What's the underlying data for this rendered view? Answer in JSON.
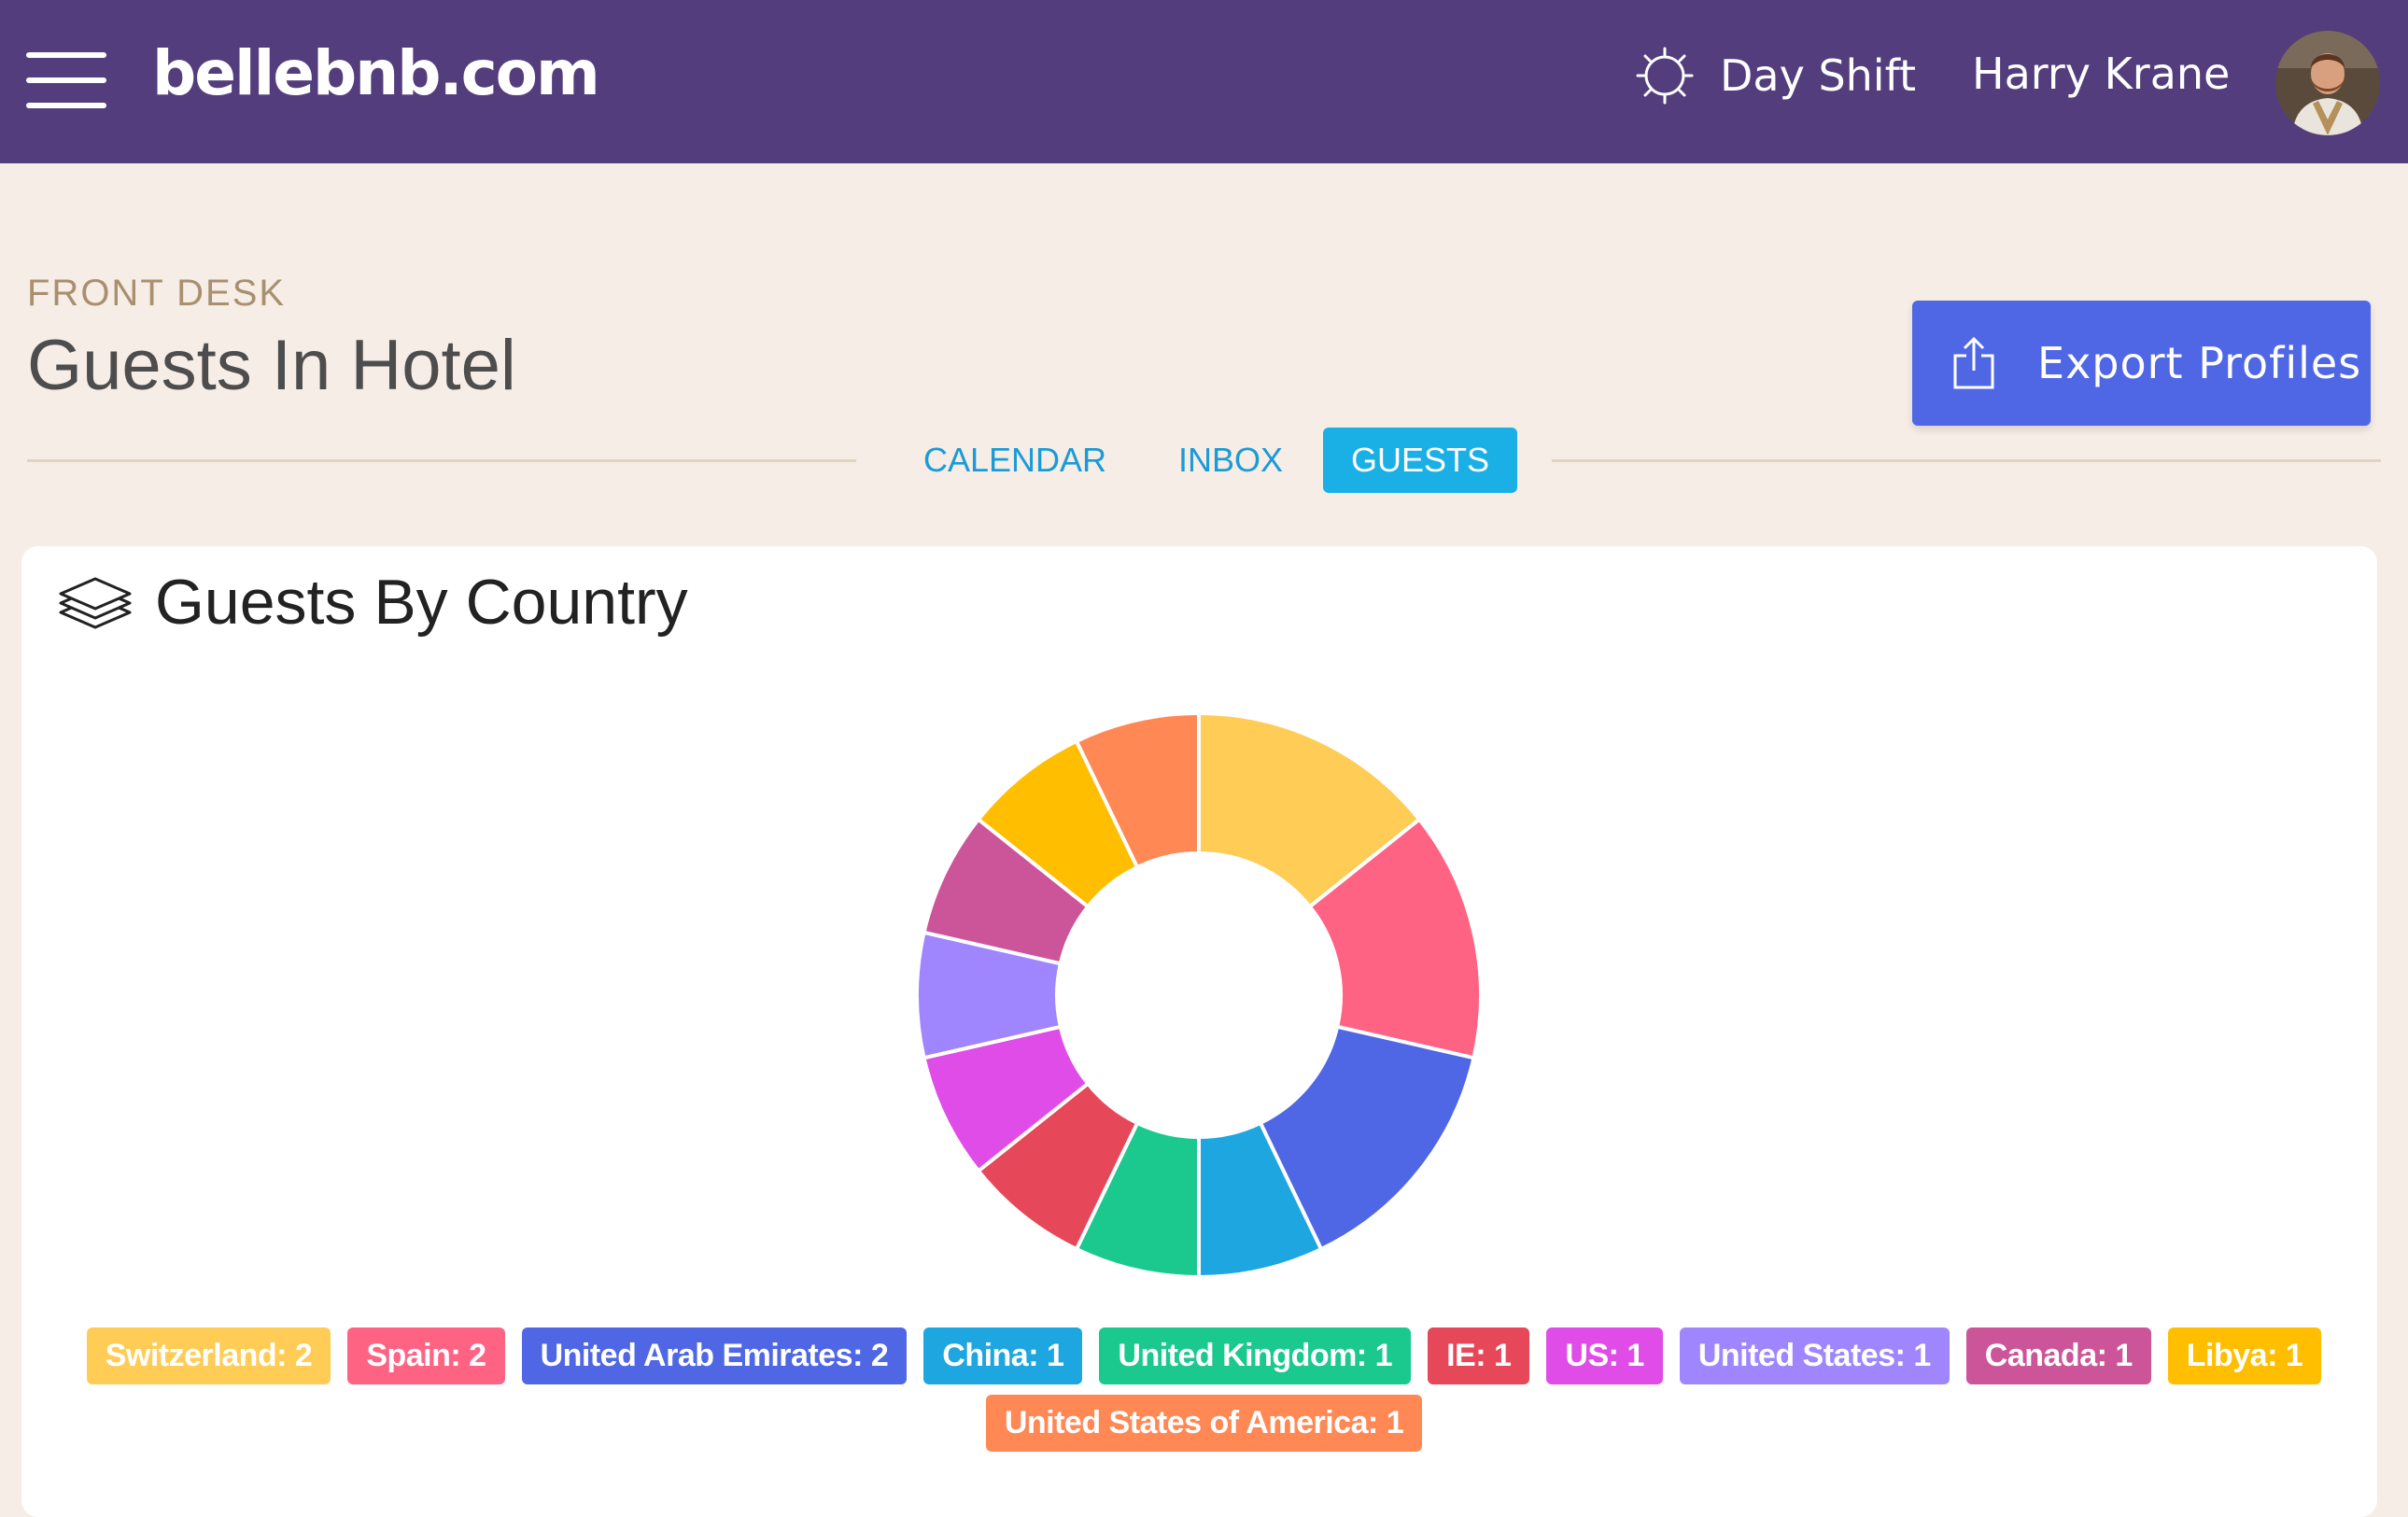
{
  "header": {
    "site_title": "bellebnb.com",
    "shift_label": "Day Shift",
    "user_name": "Harry Krane",
    "colors": {
      "bar": "#543d7c",
      "text": "#ffffff"
    }
  },
  "page": {
    "eyebrow": "FRONT DESK",
    "title": "Guests In Hotel",
    "export_label": "Export Profiles"
  },
  "tabs": [
    {
      "label": "CALENDAR",
      "active": false
    },
    {
      "label": "INBOX",
      "active": false
    },
    {
      "label": "GUESTS",
      "active": true
    }
  ],
  "card": {
    "title": "Guests By Country"
  },
  "chart_data": {
    "type": "pie",
    "donut": true,
    "title": "Guests By Country",
    "legend_position": "bottom",
    "series": [
      {
        "name": "Switzerland",
        "value": 2,
        "color": "#ffcc55"
      },
      {
        "name": "Spain",
        "value": 2,
        "color": "#ff6384"
      },
      {
        "name": "United Arab Emirates",
        "value": 2,
        "color": "#4f67e5"
      },
      {
        "name": "China",
        "value": 1,
        "color": "#1ea6e0"
      },
      {
        "name": "United Kingdom",
        "value": 1,
        "color": "#1bc98e"
      },
      {
        "name": "IE",
        "value": 1,
        "color": "#e64759"
      },
      {
        "name": "US",
        "value": 1,
        "color": "#e04ce8"
      },
      {
        "name": "United States",
        "value": 1,
        "color": "#9f86ff"
      },
      {
        "name": "Canada",
        "value": 1,
        "color": "#cc5599"
      },
      {
        "name": "Libya",
        "value": 1,
        "color": "#ffbe00"
      },
      {
        "name": "United States of America",
        "value": 1,
        "color": "#ff8855"
      }
    ]
  }
}
